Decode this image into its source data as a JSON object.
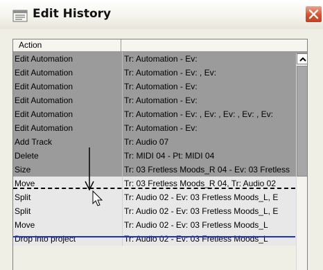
{
  "window": {
    "title": "Edit History",
    "title_icon": "list-icon",
    "close_icon": "close-icon",
    "close_color": "#d6512e"
  },
  "table": {
    "columns": [
      "Action",
      ""
    ],
    "rows": [
      {
        "action": "Edit Automation",
        "detail": "Tr: Automation - Ev:",
        "state": "undone"
      },
      {
        "action": "Edit Automation",
        "detail": "Tr: Automation - Ev: , Ev:",
        "state": "undone"
      },
      {
        "action": "Edit Automation",
        "detail": "Tr: Automation - Ev:",
        "state": "undone"
      },
      {
        "action": "Edit Automation",
        "detail": "Tr: Automation - Ev:",
        "state": "undone"
      },
      {
        "action": "Edit Automation",
        "detail": "Tr: Automation - Ev: , Ev: , Ev: , Ev: , Ev:",
        "state": "undone"
      },
      {
        "action": "Edit Automation",
        "detail": "Tr: Automation - Ev:",
        "state": "undone"
      },
      {
        "action": "Add Track",
        "detail": "Tr: Audio 07",
        "state": "undone"
      },
      {
        "action": "Delete",
        "detail": "Tr: MIDI 04 - Pt: MIDI 04",
        "state": "undone"
      },
      {
        "action": "Size",
        "detail": "Tr: 03 Fretless Moods_R 04 - Ev: 03 Fretless",
        "state": "undone"
      },
      {
        "action": "Move",
        "detail": "Tr: 03 Fretless Moods_R 04, Tr: Audio 02",
        "state": "active"
      },
      {
        "action": "Split",
        "detail": "Tr: Audio 02 - Ev: 03 Fretless Moods_L, E",
        "state": "active"
      },
      {
        "action": "Split",
        "detail": "Tr: Audio 02 - Ev: 03 Fretless Moods_L, E",
        "state": "active"
      },
      {
        "action": "Move",
        "detail": "Tr: Audio 02 - Ev: 03 Fretless Moods_L",
        "state": "active"
      },
      {
        "action": "Drop into project",
        "detail": "Tr: Audio 02 - Ev: 03 Fretless Moods_L",
        "state": "active"
      }
    ]
  },
  "colors": {
    "undone_row": "#9b9b9b",
    "active_row": "#e8e8e8",
    "undo_marker": "#1a2fd6"
  },
  "icons": {
    "scroll_up": "chevron-up-icon",
    "cursor": "mouse-pointer-icon",
    "drag": "down-arrow-icon"
  }
}
